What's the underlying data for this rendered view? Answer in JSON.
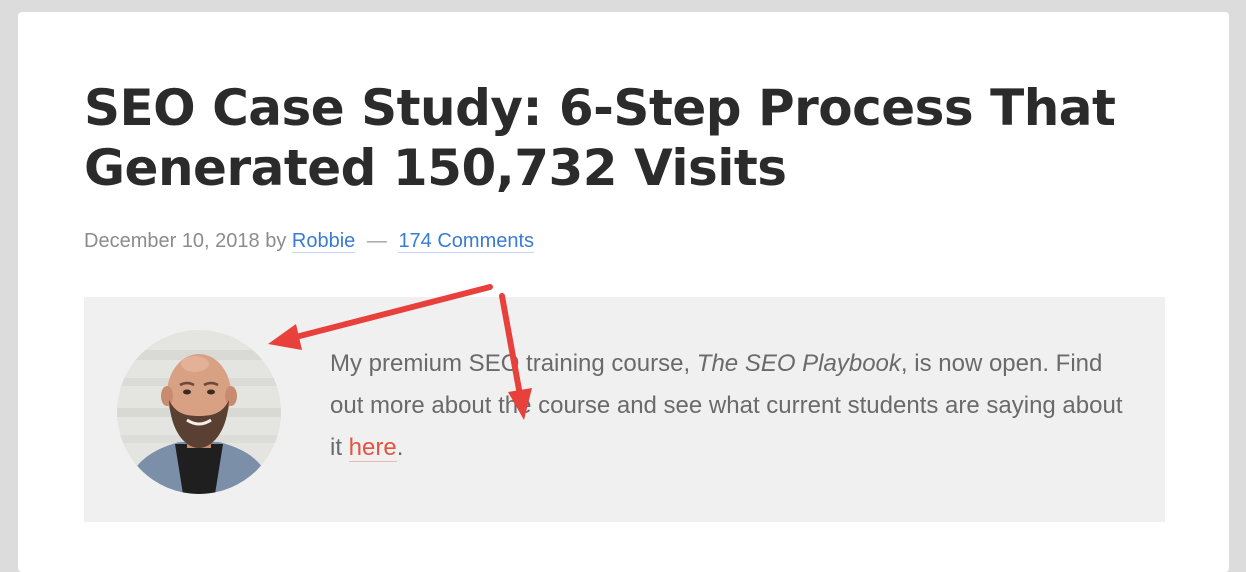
{
  "post": {
    "title": "SEO Case Study: 6-Step Process That Generated 150,732 Visits",
    "date": "December 10, 2018",
    "by": "by",
    "author": "Robbie",
    "separator": "—",
    "comments": "174 Comments"
  },
  "promo": {
    "text_before": "My premium SEO training course, ",
    "course_name": "The SEO Playbook",
    "text_middle": ", is now open. Find out more about the course and see what current students are saying about it ",
    "link_text": "here",
    "text_after": "."
  },
  "colors": {
    "link_blue": "#3a7bd5",
    "link_red": "#e2553f",
    "arrow_red": "#e8403b",
    "promo_background": "#f0f0f0",
    "page_background": "#dcdcdc"
  },
  "icons": {
    "annotation_arrow_to_avatar": "arrow-icon",
    "annotation_arrow_to_link": "arrow-icon"
  }
}
